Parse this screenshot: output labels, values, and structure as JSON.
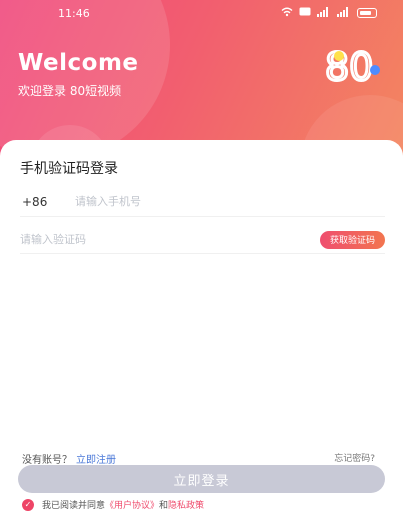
{
  "status_bar": {
    "time": "11:46"
  },
  "header": {
    "welcome": "Welcome",
    "subtitle": "欢迎登录 80短视频",
    "logo_text": "80"
  },
  "form": {
    "title": "手机验证码登录",
    "country_code": "+86",
    "phone_placeholder": "请输入手机号",
    "code_placeholder": "请输入验证码",
    "get_code_label": "获取验证码"
  },
  "footer": {
    "no_account": "没有账号？",
    "register_label": "立即注册",
    "forgot_label": "忘记密码?",
    "login_label": "立即登录",
    "agree_prefix": "我已阅读并同意",
    "user_agreement": "《用户协议》",
    "and": "和",
    "privacy_policy": "隐私政策"
  },
  "colors": {
    "header_gradient_start": "#f0457a",
    "header_gradient_end": "#f3875f",
    "accent": "#ef4e6f",
    "link_blue": "#4a78d8",
    "login_button_disabled": "#c8c9d6"
  }
}
